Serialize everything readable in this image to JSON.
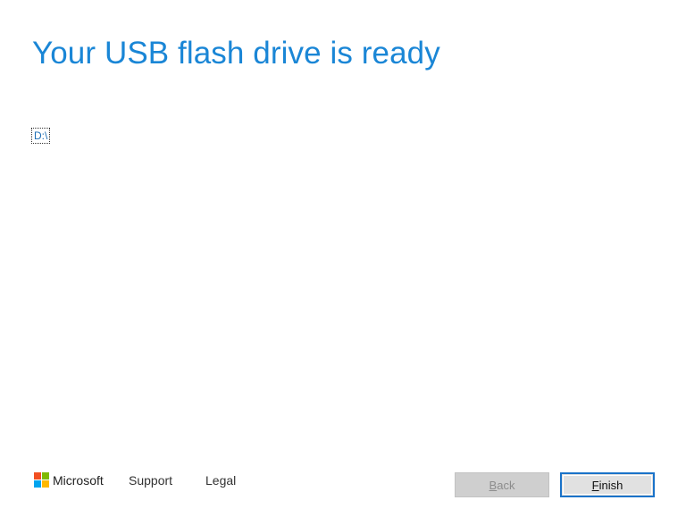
{
  "main": {
    "title": "Your USB flash drive is ready",
    "drive_label": "D:\\"
  },
  "footer": {
    "brand": "Microsoft",
    "brand_colors": [
      "#f25022",
      "#7fba00",
      "#00a4ef",
      "#ffb900"
    ],
    "support_label": "Support",
    "legal_label": "Legal"
  },
  "buttons": {
    "back_label": "Back",
    "finish_label": "Finish"
  },
  "colors": {
    "title": "#1a86d6",
    "finish_border": "#1a73c9"
  }
}
